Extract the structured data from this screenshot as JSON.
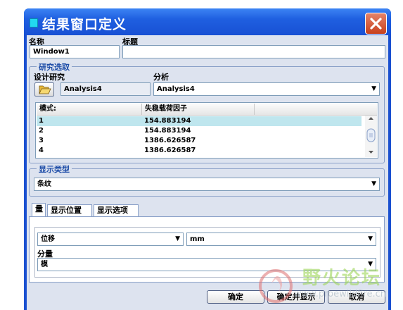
{
  "window": {
    "title": "结果窗口定义"
  },
  "name": {
    "label": "名称",
    "value": "Window1"
  },
  "caption": {
    "label": "标题",
    "value": ""
  },
  "study": {
    "group_title": "研究选取",
    "design_label": "设计研究",
    "design_value": "Analysis4",
    "analysis_label": "分析",
    "analysis_value": "Analysis4"
  },
  "modes": {
    "columns": [
      "模式:",
      "失稳载荷因子"
    ],
    "rows": [
      {
        "mode": "1",
        "factor": "154.883194"
      },
      {
        "mode": "2",
        "factor": "154.883194"
      },
      {
        "mode": "3",
        "factor": "1386.626587"
      },
      {
        "mode": "4",
        "factor": "1386.626587"
      }
    ]
  },
  "display_type": {
    "group_title": "显示类型",
    "value": "条纹"
  },
  "tabs": [
    {
      "label": "量"
    },
    {
      "label": "显示位置"
    },
    {
      "label": "显示选项"
    }
  ],
  "quantity": {
    "type_value": "位移",
    "unit_value": "mm",
    "component_label": "分量",
    "component_value": "模"
  },
  "buttons": {
    "ok": "确定",
    "ok_show": "确定并显示",
    "cancel": "取消"
  },
  "watermark": {
    "text": "野火论坛",
    "url": "www.proewildfire.cn"
  }
}
